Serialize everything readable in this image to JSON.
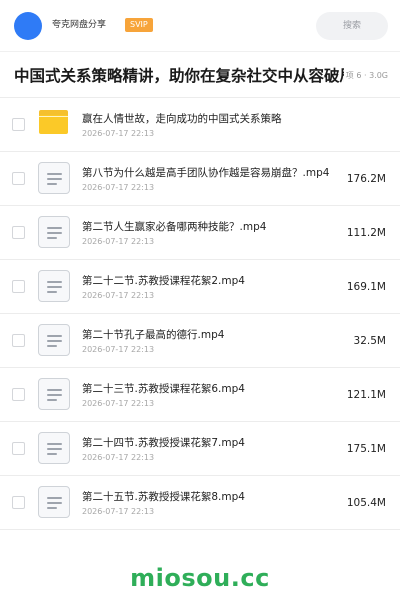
{
  "header": {
    "user_name": "夸克网盘分享",
    "vip_label": "SVIP",
    "search_label": "搜索"
  },
  "share": {
    "title": "中国式关系策略精讲，助你在复杂社交中从容破局",
    "item_count": "6 项",
    "separator": "·",
    "total_size": "3.0G"
  },
  "files": [
    {
      "type": "folder",
      "name": "赢在人情世故，走向成功的中国式关系策略",
      "date": "2026-07-17 22:13",
      "size": ""
    },
    {
      "type": "file",
      "name": "第八节为什么越是高手团队协作越是容易崩盘？.mp4",
      "date": "2026-07-17 22:13",
      "size": "176.2M"
    },
    {
      "type": "file",
      "name": "第二节人生赢家必备哪两种技能？.mp4",
      "date": "2026-07-17 22:13",
      "size": "111.2M"
    },
    {
      "type": "file",
      "name": "第二十二节.苏教授课程花絮2.mp4",
      "date": "2026-07-17 22:13",
      "size": "169.1M"
    },
    {
      "type": "file",
      "name": "第二十节孔子最高的德行.mp4",
      "date": "2026-07-17 22:13",
      "size": "32.5M"
    },
    {
      "type": "file",
      "name": "第二十三节.苏教授课程花絮6.mp4",
      "date": "2026-07-17 22:13",
      "size": "121.1M"
    },
    {
      "type": "file",
      "name": "第二十四节.苏教授授课花絮7.mp4",
      "date": "2026-07-17 22:13",
      "size": "175.1M"
    },
    {
      "type": "file",
      "name": "第二十五节.苏教授授课花絮8.mp4",
      "date": "2026-07-17 22:13",
      "size": "105.4M"
    }
  ],
  "icons": {
    "folder": "folder-icon",
    "file": "video-file-icon"
  },
  "colors": {
    "accent": "#2f7bf6",
    "vip": "#f7a43a",
    "folder": "#fbc928",
    "watermark": "#2fae59"
  },
  "watermark": "miosou.cc"
}
